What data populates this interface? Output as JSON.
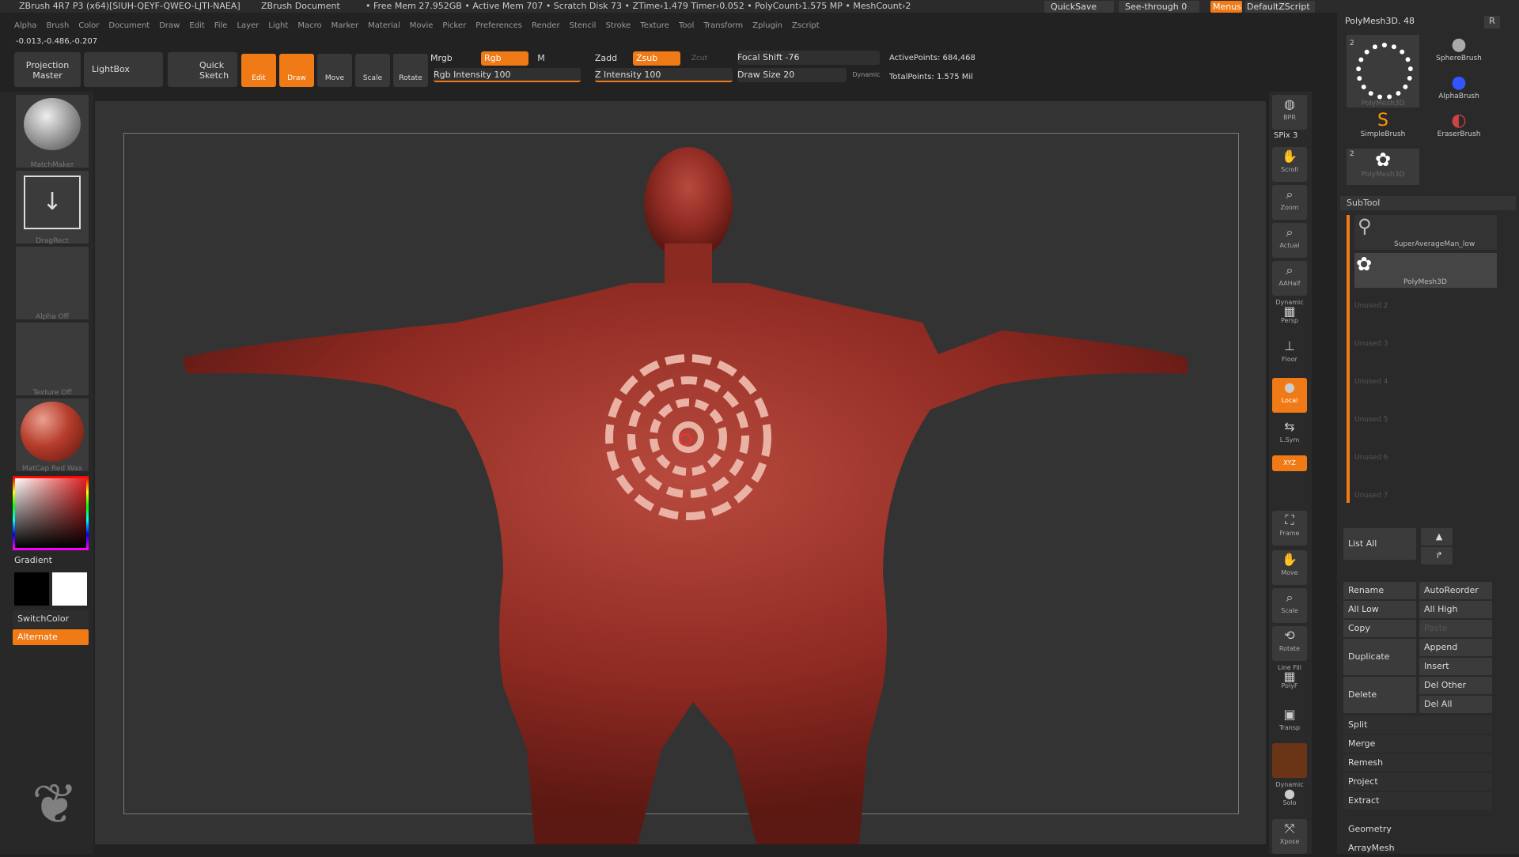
{
  "titlebar": {
    "app": "ZBrush 4R7 P3 (x64)[SIUH-QEYF-QWEO-LJTI-NAEA]",
    "doc": "ZBrush Document",
    "stats": "• Free Mem 27.952GB • Active Mem 707 • Scratch Disk 73 • ZTime›1.479 Timer›0.052 • PolyCount›1.575 MP • MeshCount›2",
    "quicksave": "QuickSave",
    "seethrough": "See-through  0",
    "menus": "Menus",
    "script": "DefaultZScript"
  },
  "menu": [
    "Alpha",
    "Brush",
    "Color",
    "Document",
    "Draw",
    "Edit",
    "File",
    "Layer",
    "Light",
    "Macro",
    "Marker",
    "Material",
    "Movie",
    "Picker",
    "Preferences",
    "Render",
    "Stencil",
    "Stroke",
    "Texture",
    "Tool",
    "Transform",
    "Zplugin",
    "Zscript"
  ],
  "coords": "-0.013,-0.486,-0.207",
  "shelf": {
    "projection": "Projection Master",
    "lightbox": "LightBox",
    "quicksketch": "Quick Sketch",
    "edit": "Edit",
    "draw": "Draw",
    "move": "Move",
    "scale": "Scale",
    "rotate": "Rotate",
    "mrgb": "Mrgb",
    "rgb": "Rgb",
    "m": "M",
    "zadd": "Zadd",
    "zsub": "Zsub",
    "zcut": "Zcut",
    "rgb_intensity": "Rgb Intensity 100",
    "z_intensity": "Z Intensity 100",
    "focal": "Focal Shift -76",
    "drawsize": "Draw Size 20",
    "dynamic": "Dynamic",
    "active": "ActivePoints: 684,468",
    "total": "TotalPoints: 1.575 Mil"
  },
  "left": {
    "matchmaker": "MatchMaker",
    "dragrect": "DragRect",
    "alpha": "Alpha  Off",
    "texture": "Texture  Off",
    "matcap": "MatCap Red Wax",
    "gradient": "Gradient",
    "switchcolor": "SwitchColor",
    "alternate": "Alternate"
  },
  "right": {
    "bpr": "BPR",
    "spix": "SPix 3",
    "scroll": "Scroll",
    "zoom": "Zoom",
    "actual": "Actual",
    "aahalf": "AAHalf",
    "dynamic": "Dynamic",
    "persp": "Persp",
    "floor": "Floor",
    "local": "Local",
    "lsym": "L.Sym",
    "xyz": "XYZ",
    "frame": "Frame",
    "move": "Move",
    "scale": "Scale",
    "rotate": "Rotate",
    "linefill": "Line Fill",
    "polyf": "PolyF",
    "transp": "Transp",
    "dynamic2": "Dynamic",
    "solo": "Solo",
    "xpose": "Xpose"
  },
  "tool": {
    "header": "PolyMesh3D. 48",
    "r": "R",
    "items": [
      "PolyMesh3D",
      "SphereBrush",
      "AlphaBrush",
      "SimpleBrush",
      "EraserBrush",
      "PolyMesh3D"
    ],
    "num1": "2",
    "num2": "2"
  },
  "subtool": {
    "title": "SubTool",
    "items": [
      "SuperAverageMan_low",
      "PolyMesh3D"
    ],
    "unused": [
      "Unused 2",
      "Unused 3",
      "Unused 4",
      "Unused 5",
      "Unused 6",
      "Unused 7"
    ],
    "listall": "List  All",
    "rename": "Rename",
    "autoreorder": "AutoReorder",
    "alllow": "All Low",
    "allhigh": "All High",
    "copy": "Copy",
    "paste": "Paste",
    "append": "Append",
    "duplicate": "Duplicate",
    "insert": "Insert",
    "delete": "Delete",
    "delother": "Del Other",
    "delall": "Del All",
    "split": "Split",
    "merge": "Merge",
    "remesh": "Remesh",
    "project": "Project",
    "extract": "Extract",
    "geometry": "Geometry",
    "arraymesh": "ArrayMesh"
  }
}
